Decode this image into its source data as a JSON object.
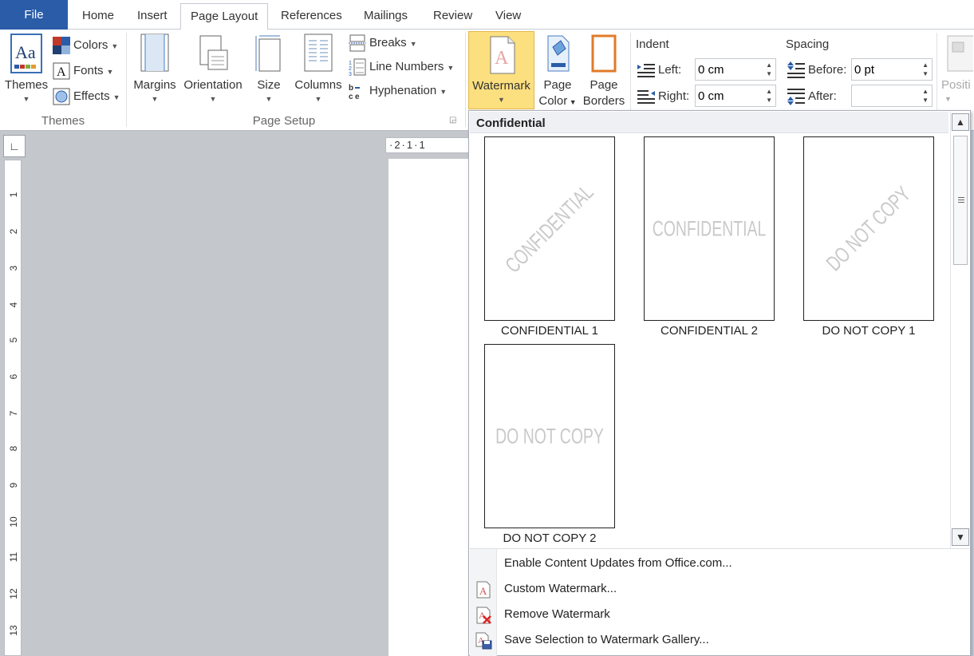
{
  "tabs": [
    {
      "label": "File"
    },
    {
      "label": "Home"
    },
    {
      "label": "Insert"
    },
    {
      "label": "Page Layout"
    },
    {
      "label": "References"
    },
    {
      "label": "Mailings"
    },
    {
      "label": "Review"
    },
    {
      "label": "View"
    }
  ],
  "ribbon": {
    "themes_group": {
      "label": "Themes",
      "themes_button": "Themes",
      "colors": "Colors",
      "fonts": "Fonts",
      "effects": "Effects"
    },
    "page_setup_group": {
      "label": "Page Setup",
      "margins": "Margins",
      "orientation": "Orientation",
      "size": "Size",
      "columns": "Columns",
      "breaks": "Breaks",
      "line_numbers": "Line Numbers",
      "hyphenation": "Hyphenation"
    },
    "page_background": {
      "watermark": "Watermark",
      "page_color_1": "Page",
      "page_color_2": "Color",
      "page_borders_1": "Page",
      "page_borders_2": "Borders"
    },
    "indent": {
      "label": "Indent",
      "left_label": "Left:",
      "left_value": "0 cm",
      "right_label": "Right:",
      "right_value": "0 cm"
    },
    "spacing": {
      "label": "Spacing",
      "before_label": "Before:",
      "before_value": "0 pt",
      "after_label": "After:",
      "after_value": ""
    },
    "position_partial": "Positi"
  },
  "ruler": {
    "horizontal": "·2·1·1",
    "vertical_numbers": [
      "1",
      "2",
      "3",
      "4",
      "5",
      "6",
      "7",
      "8",
      "9",
      "10",
      "11",
      "12",
      "13"
    ]
  },
  "watermark_gallery": {
    "section": "Confidential",
    "items": [
      {
        "caption": "CONFIDENTIAL 1",
        "text": "CONFIDENTIAL",
        "style": "diagonal"
      },
      {
        "caption": "CONFIDENTIAL 2",
        "text": "CONFIDENTIAL",
        "style": "horizontal"
      },
      {
        "caption": "DO NOT COPY 1",
        "text": "DO NOT COPY",
        "style": "diagonal"
      },
      {
        "caption": "DO NOT COPY 2",
        "text": "DO NOT COPY",
        "style": "horizontal"
      }
    ],
    "menu": [
      {
        "label": "Enable Content Updates from Office.com...",
        "icon": ""
      },
      {
        "label": "Custom Watermark...",
        "icon": "custom-watermark-icon"
      },
      {
        "label": "Remove Watermark",
        "icon": "remove-watermark-icon"
      },
      {
        "label": "Save Selection to Watermark Gallery...",
        "icon": "save-watermark-icon"
      }
    ]
  },
  "colors": {
    "file_tab": "#2a5ca8",
    "watermark_highlight": "#fcdf7f",
    "doc_background": "#c4c7cb"
  }
}
